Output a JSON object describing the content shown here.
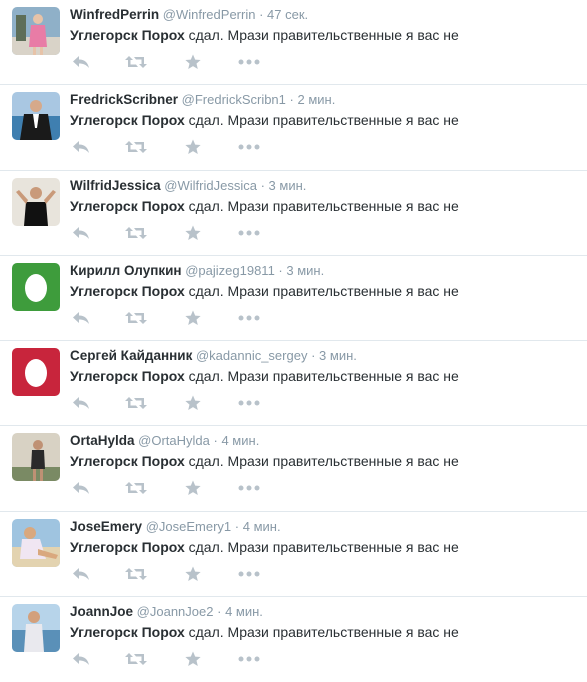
{
  "colors": {
    "name": "#292f33",
    "muted": "#8899a6",
    "icon": "#b8c2ca",
    "divider": "#e1e8ed",
    "egg_green": "#3e9c3c",
    "egg_red": "#c8253c"
  },
  "tweets": [
    {
      "fullname": "WinfredPerrin",
      "username": "@WinfredPerrin",
      "sep": "·",
      "time": "47 сек.",
      "text_bold": "Углегорск Порох",
      "text_rest": " сдал. Мрази правительственные я вас не",
      "avatar": "photo-pink"
    },
    {
      "fullname": "FredrickScribner",
      "username": "@FredrickScribn1",
      "sep": "·",
      "time": "2 мин.",
      "text_bold": "Углегорск Порох",
      "text_rest": " сдал. Мрази правительственные я вас не",
      "avatar": "photo-man-sea"
    },
    {
      "fullname": "WilfridJessica",
      "username": "@WilfridJessica",
      "sep": "·",
      "time": "3 мин.",
      "text_bold": "Углегорск Порох",
      "text_rest": " сдал. Мрази правительственные я вас не",
      "avatar": "photo-man-black"
    },
    {
      "fullname": "Кирилл Олупкин",
      "username": "@pajizeg19811",
      "sep": "·",
      "time": "3 мин.",
      "text_bold": "Углегорск Порох",
      "text_rest": " сдал. Мрази правительственные я вас не",
      "avatar": "egg-green"
    },
    {
      "fullname": "Сергей Кайданник",
      "username": "@kadannic_sergey",
      "sep": "·",
      "time": "3 мин.",
      "text_bold": "Углегорск Порох",
      "text_rest": " сдал. Мрази правительственные я вас не",
      "avatar": "egg-red"
    },
    {
      "fullname": "OrtaHylda",
      "username": "@OrtaHylda",
      "sep": "·",
      "time": "4 мин.",
      "text_bold": "Углегорск Порох",
      "text_rest": " сдал. Мрази правительственные я вас не",
      "avatar": "photo-woman-dark"
    },
    {
      "fullname": "JoseEmery",
      "username": "@JoseEmery1",
      "sep": "·",
      "time": "4 мин.",
      "text_bold": "Углегорск Порох",
      "text_rest": " сдал. Мрази правительственные я вас не",
      "avatar": "photo-woman-beach"
    },
    {
      "fullname": "JoannJoe",
      "username": "@JoannJoe2",
      "sep": "·",
      "time": "4 мин.",
      "text_bold": "Углегорск Порох",
      "text_rest": " сдал. Мрази правительственные я вас не",
      "avatar": "photo-woman-sea"
    }
  ],
  "icons": {
    "reply": "reply-icon",
    "retweet": "retweet-icon",
    "favorite": "star-icon",
    "more": "more-icon"
  }
}
